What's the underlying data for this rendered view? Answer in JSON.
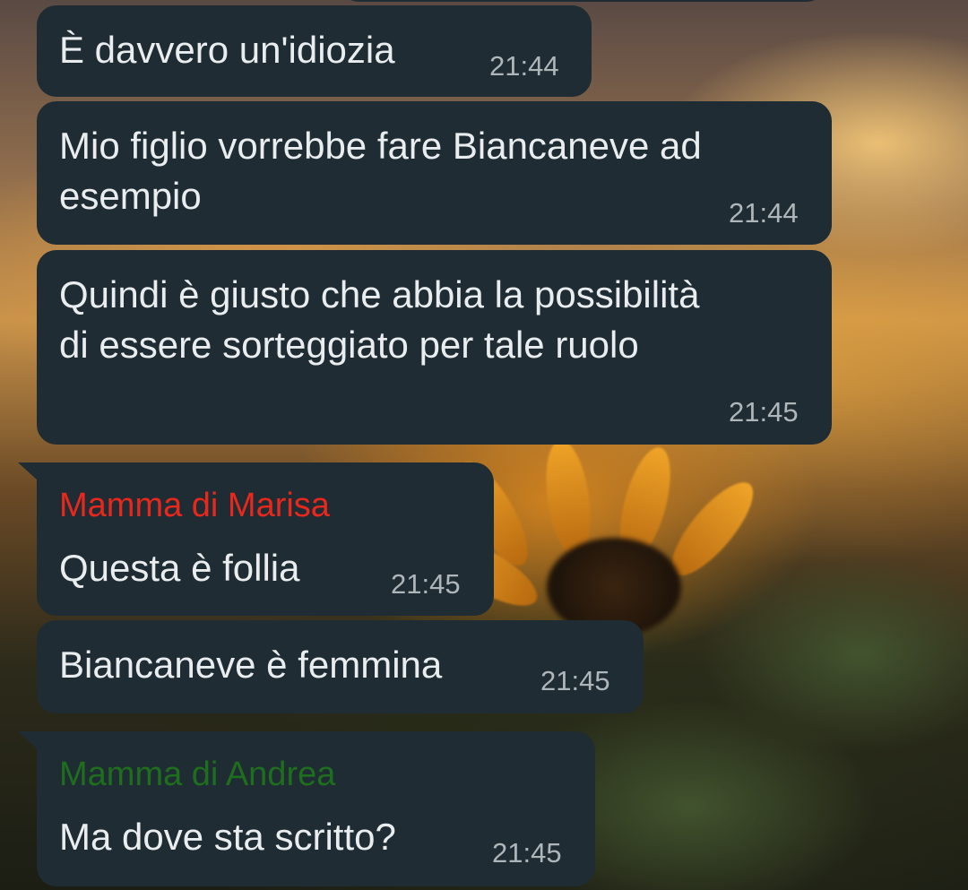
{
  "colors": {
    "bubble_background": "#1f2c33",
    "message_text": "#e9edef",
    "timestamp_text": "#aeb6ba",
    "sender_marisa": "#e8281c",
    "sender_andrea": "#1e6e1e"
  },
  "messages": [
    {
      "text": "È davvero un'idiozia",
      "time": "21:44"
    },
    {
      "text_lines": [
        "Mio figlio vorrebbe fare Biancaneve ad",
        "esempio"
      ],
      "time": "21:44"
    },
    {
      "text_lines": [
        "Quindi è giusto che abbia la possibilità",
        "di essere sorteggiato per tale ruolo"
      ],
      "time": "21:45"
    },
    {
      "sender": "Mamma di Marisa",
      "text": "Questa è follia",
      "time": "21:45"
    },
    {
      "text": "Biancaneve è femmina",
      "time": "21:45"
    },
    {
      "sender": "Mamma di Andrea",
      "text": "Ma dove sta scritto?",
      "time": "21:45"
    }
  ]
}
